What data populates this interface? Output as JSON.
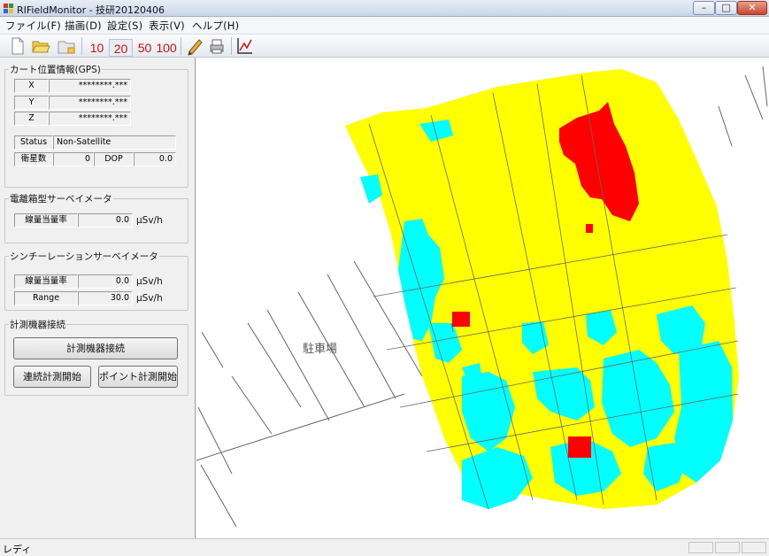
{
  "window": {
    "title": "RIFieldMonitor - 技研20120406",
    "min_glyph": "–",
    "max_glyph": "□",
    "close_glyph": "✕"
  },
  "menu": [
    "ファイル(F)",
    "描画(D)",
    "設定(S)",
    "表示(V)",
    "ヘルプ(H)"
  ],
  "toolbar": {
    "zoom_buttons": [
      "10",
      "20",
      "50",
      "100"
    ],
    "icons": [
      "new-file-icon",
      "open-folder-icon",
      "save-icon",
      "pen-icon",
      "print-icon",
      "axes-icon"
    ]
  },
  "gps": {
    "title": "カート位置情報(GPS)",
    "rows": [
      {
        "label": "X",
        "value": "********.***"
      },
      {
        "label": "Y",
        "value": "********.***"
      },
      {
        "label": "Z",
        "value": "********.***"
      }
    ],
    "status_label": "Status",
    "status_value": "Non-Satellite",
    "sat_label": "衛星数",
    "sat_value": "0",
    "dop_label": "DOP",
    "dop_value": "0.0"
  },
  "survey": {
    "title": "電離箱型サーベイメータ",
    "rate_label": "線量当量率",
    "rate_value": "0.0",
    "unit": "μSv/h"
  },
  "scint": {
    "title": "シンチーレーションサーベイメータ",
    "rate_label": "線量当量率",
    "rate_value": "0.0",
    "rate_unit": "μSv/h",
    "range_label": "Range",
    "range_value": "30.0",
    "range_unit": "μSv/h"
  },
  "conn": {
    "title": "計測機器接続",
    "connect_button": "計測機器接続",
    "continuous_button": "連続計測開始",
    "point_button": "ポイント計測開始"
  },
  "map": {
    "label": "駐車場",
    "colors": {
      "low": "#ffff00",
      "mid": "#00ffff",
      "high": "#ff0000",
      "lines": "#666666"
    }
  },
  "status": {
    "text": "レディ"
  }
}
